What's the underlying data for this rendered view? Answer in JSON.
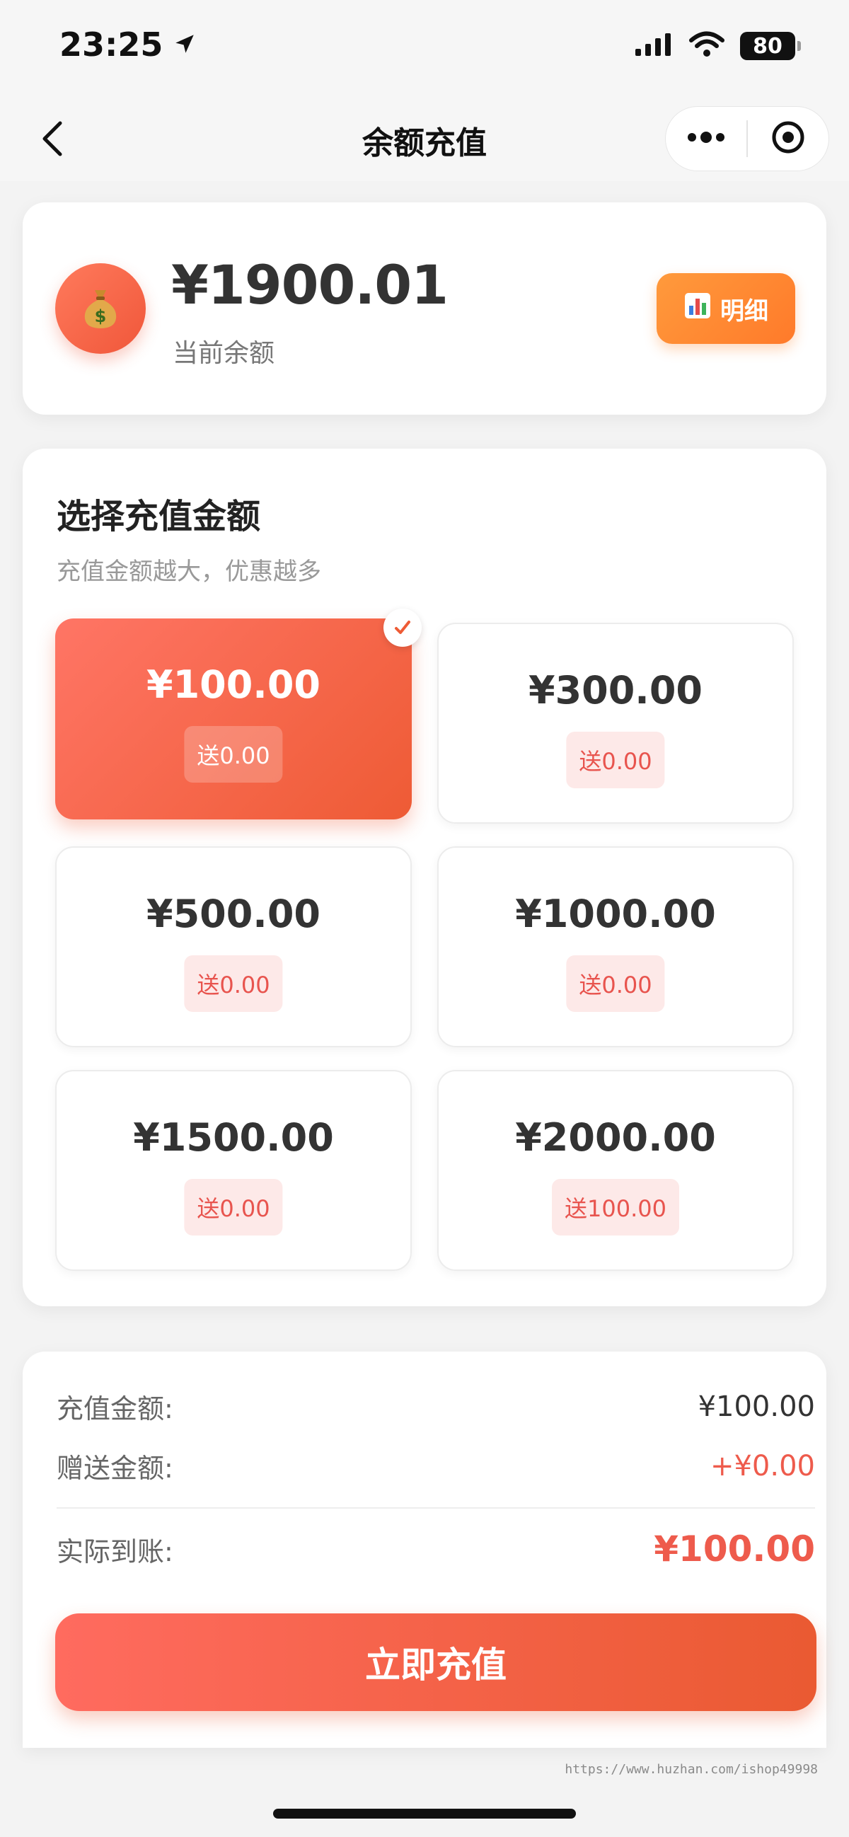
{
  "status_bar": {
    "time": "23:25",
    "battery": "80"
  },
  "nav": {
    "title": "余额充值"
  },
  "balance": {
    "amount": "¥1900.01",
    "label": "当前余额",
    "detail_label": "明细"
  },
  "select": {
    "title": "选择充值金额",
    "subtitle": "充值金额越大，优惠越多",
    "options": [
      {
        "price": "¥100.00",
        "bonus": "送0.00",
        "selected": true
      },
      {
        "price": "¥300.00",
        "bonus": "送0.00",
        "selected": false
      },
      {
        "price": "¥500.00",
        "bonus": "送0.00",
        "selected": false
      },
      {
        "price": "¥1000.00",
        "bonus": "送0.00",
        "selected": false
      },
      {
        "price": "¥1500.00",
        "bonus": "送0.00",
        "selected": false
      },
      {
        "price": "¥2000.00",
        "bonus": "送100.00",
        "selected": false
      }
    ]
  },
  "summary": {
    "recharge_label": "充值金额:",
    "recharge_value": "¥100.00",
    "gift_label": "赠送金额:",
    "gift_value": "+¥0.00",
    "actual_label": "实际到账:",
    "actual_value": "¥100.00",
    "button_label": "立即充值"
  },
  "watermark": "https://www.huzhan.com/ishop49998",
  "colors": {
    "accent": "#ee5b35",
    "accent_light": "#ff7565",
    "detail_button": "#ff8a30",
    "bonus_bg": "#fde9e8"
  }
}
